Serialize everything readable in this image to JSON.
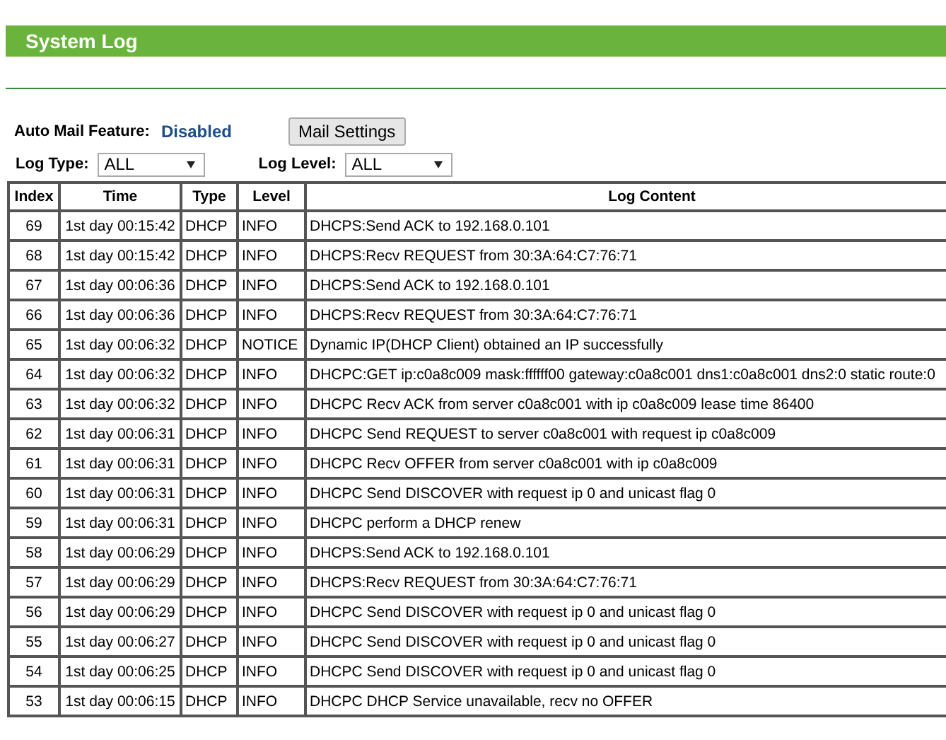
{
  "title": "System Log",
  "auto_mail": {
    "label": "Auto Mail Feature:",
    "value": "Disabled"
  },
  "mail_settings_button": "Mail Settings",
  "filters": [
    {
      "label": "Log Type:",
      "value": "ALL"
    },
    {
      "label": "Log Level:",
      "value": "ALL"
    }
  ],
  "table": {
    "columns": [
      "Index",
      "Time",
      "Type",
      "Level",
      "Log Content"
    ],
    "rows": [
      [
        "69",
        "1st day 00:15:42",
        "DHCP",
        "INFO",
        "DHCPS:Send ACK to 192.168.0.101"
      ],
      [
        "68",
        "1st day 00:15:42",
        "DHCP",
        "INFO",
        "DHCPS:Recv REQUEST from 30:3A:64:C7:76:71"
      ],
      [
        "67",
        "1st day 00:06:36",
        "DHCP",
        "INFO",
        "DHCPS:Send ACK to 192.168.0.101"
      ],
      [
        "66",
        "1st day 00:06:36",
        "DHCP",
        "INFO",
        "DHCPS:Recv REQUEST from 30:3A:64:C7:76:71"
      ],
      [
        "65",
        "1st day 00:06:32",
        "DHCP",
        "NOTICE",
        "Dynamic IP(DHCP Client) obtained an IP successfully"
      ],
      [
        "64",
        "1st day 00:06:32",
        "DHCP",
        "INFO",
        "DHCPC:GET ip:c0a8c009 mask:ffffff00 gateway:c0a8c001 dns1:c0a8c001 dns2:0 static route:0"
      ],
      [
        "63",
        "1st day 00:06:32",
        "DHCP",
        "INFO",
        "DHCPC Recv ACK from server c0a8c001 with ip c0a8c009 lease time 86400"
      ],
      [
        "62",
        "1st day 00:06:31",
        "DHCP",
        "INFO",
        "DHCPC Send REQUEST to server c0a8c001 with request ip c0a8c009"
      ],
      [
        "61",
        "1st day 00:06:31",
        "DHCP",
        "INFO",
        "DHCPC Recv OFFER from server c0a8c001 with ip c0a8c009"
      ],
      [
        "60",
        "1st day 00:06:31",
        "DHCP",
        "INFO",
        "DHCPC Send DISCOVER with request ip 0 and unicast flag 0"
      ],
      [
        "59",
        "1st day 00:06:31",
        "DHCP",
        "INFO",
        "DHCPC perform a DHCP renew"
      ],
      [
        "58",
        "1st day 00:06:29",
        "DHCP",
        "INFO",
        "DHCPS:Send ACK to 192.168.0.101"
      ],
      [
        "57",
        "1st day 00:06:29",
        "DHCP",
        "INFO",
        "DHCPS:Recv REQUEST from 30:3A:64:C7:76:71"
      ],
      [
        "56",
        "1st day 00:06:29",
        "DHCP",
        "INFO",
        "DHCPC Send DISCOVER with request ip 0 and unicast flag 0"
      ],
      [
        "55",
        "1st day 00:06:27",
        "DHCP",
        "INFO",
        "DHCPC Send DISCOVER with request ip 0 and unicast flag 0"
      ],
      [
        "54",
        "1st day 00:06:25",
        "DHCP",
        "INFO",
        "DHCPC Send DISCOVER with request ip 0 and unicast flag 0"
      ],
      [
        "53",
        "1st day 00:06:15",
        "DHCP",
        "INFO",
        "DHCPC DHCP Service unavailable, recv no OFFER"
      ]
    ]
  }
}
